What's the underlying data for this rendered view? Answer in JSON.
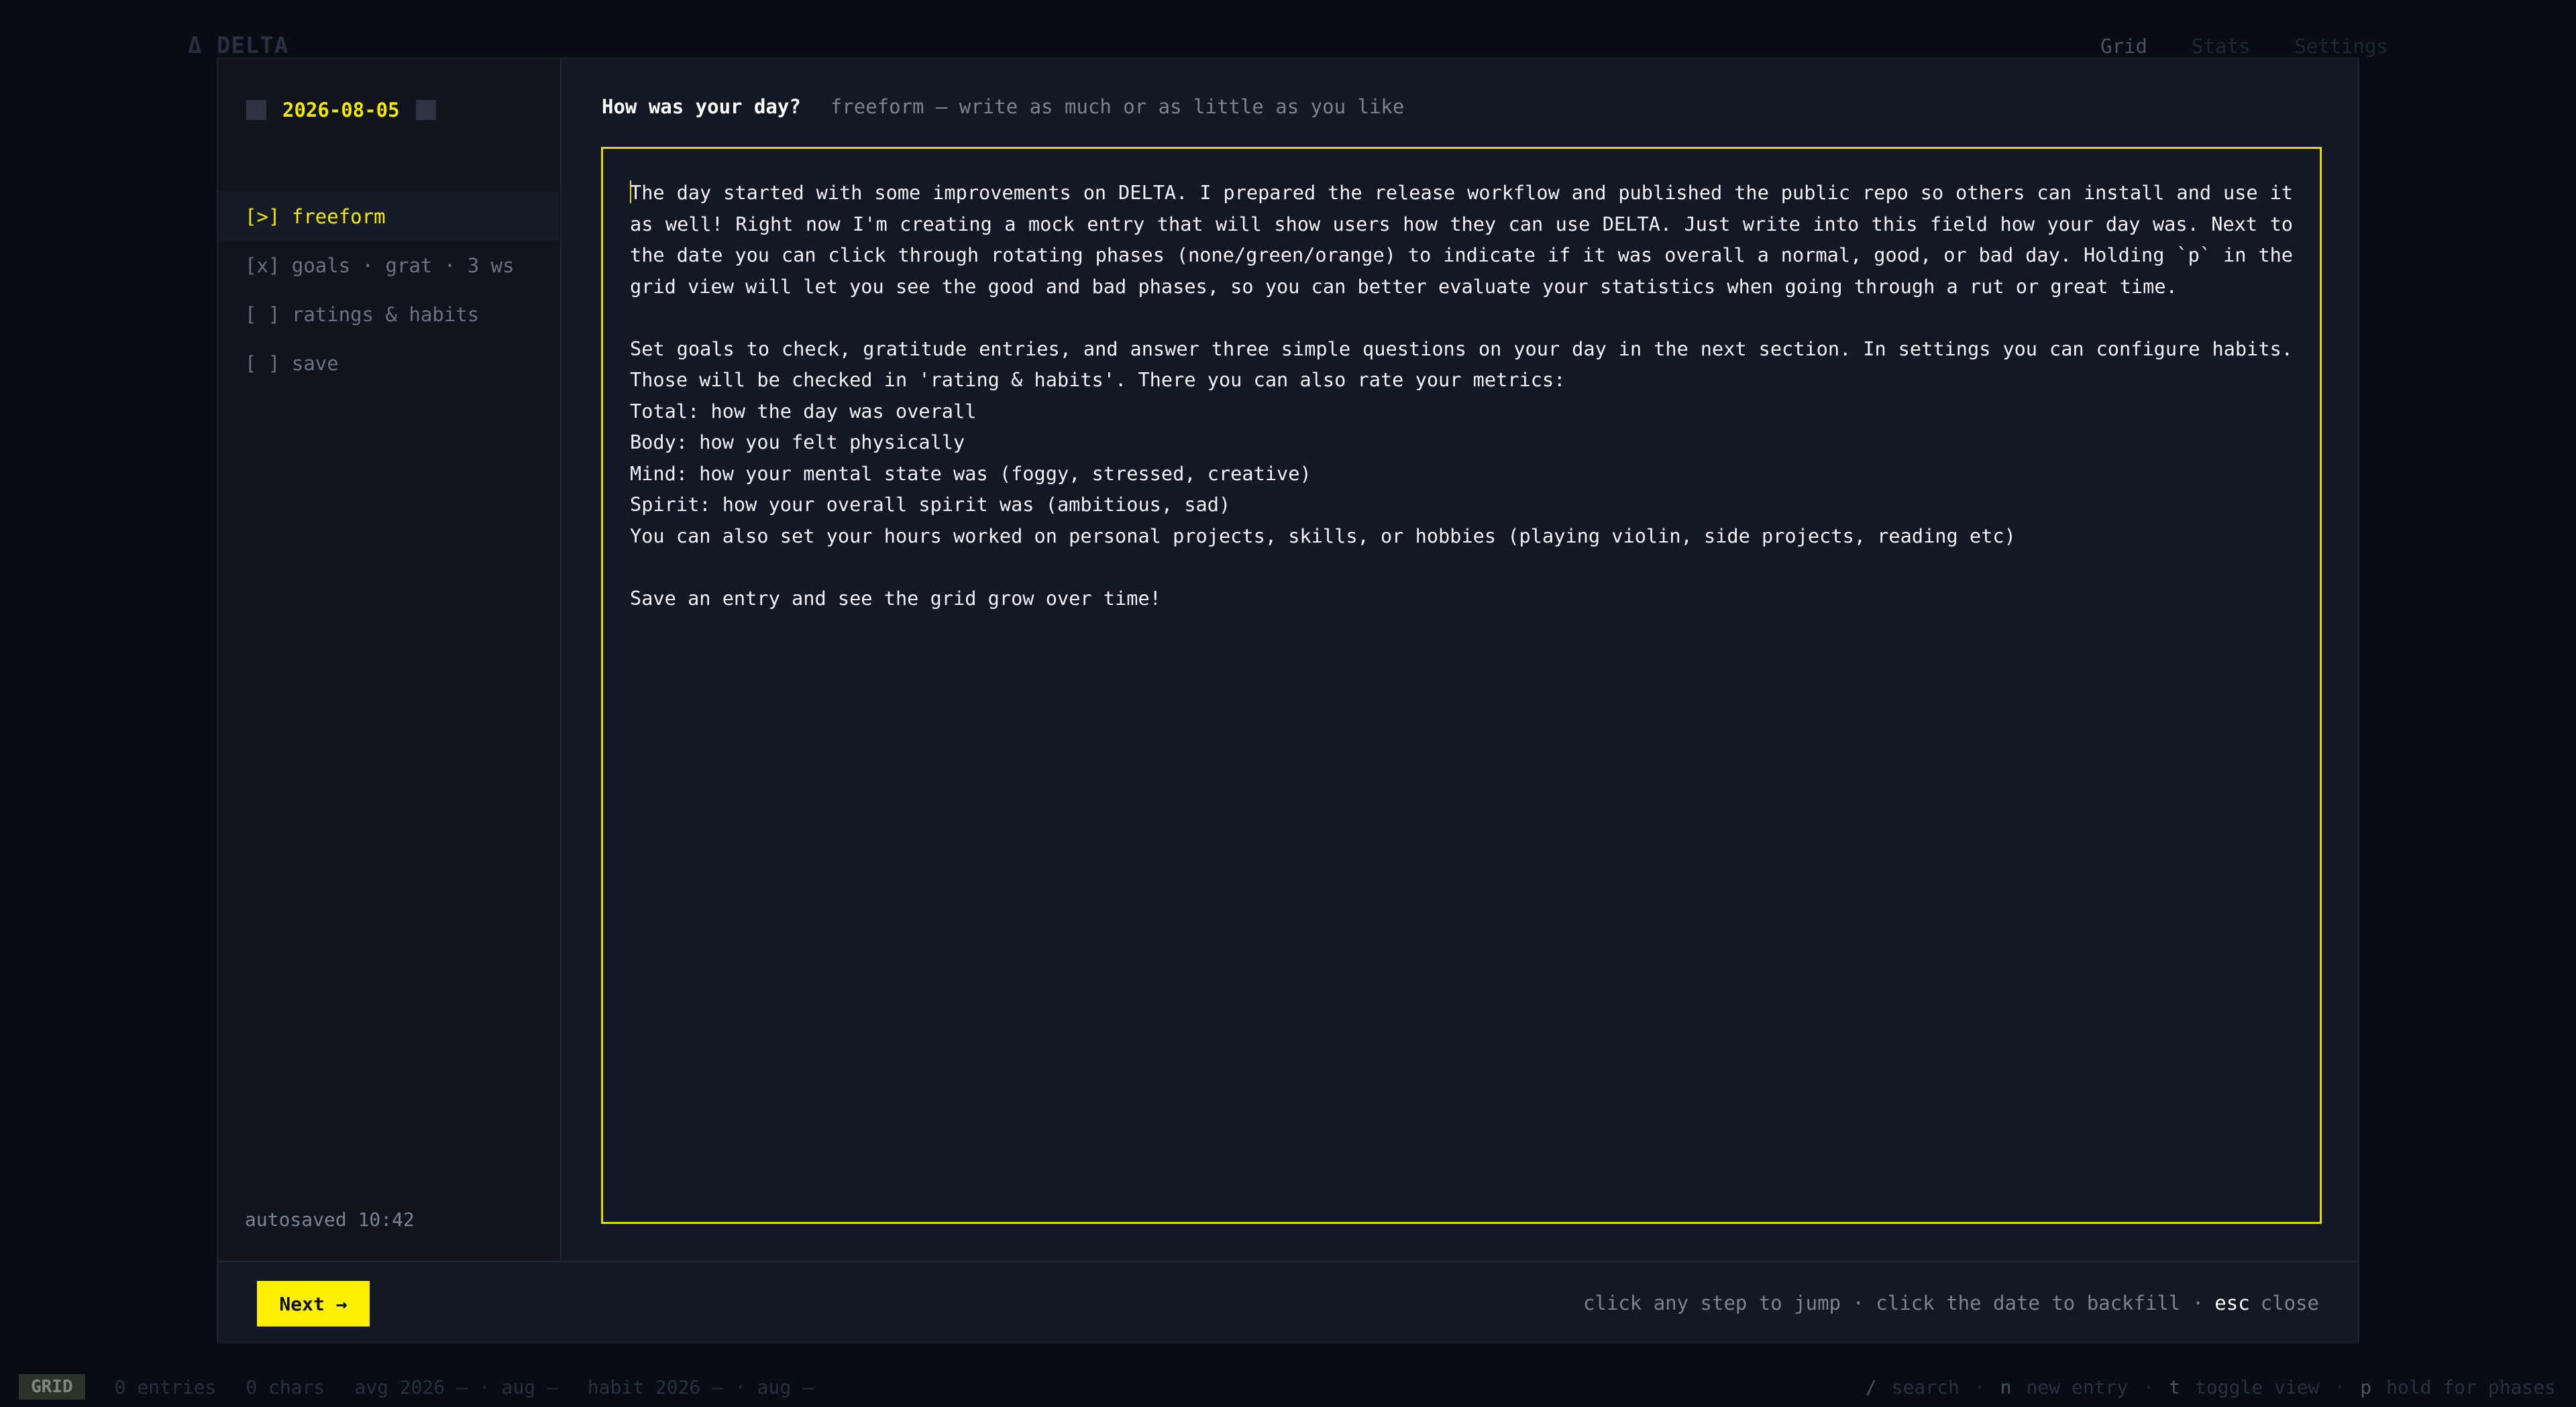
{
  "app": {
    "brand": "Δ DELTA"
  },
  "topnav": [
    "Grid",
    "Stats",
    "Settings"
  ],
  "statusbar": {
    "mode": "GRID",
    "entries": "0 entries",
    "chars": "0 chars",
    "avg": "avg 2026 — · aug —",
    "habit": "habit 2026 — · aug —",
    "shortcuts": [
      {
        "key": "/",
        "label": "search"
      },
      {
        "key": "n",
        "label": "new entry"
      },
      {
        "key": "t",
        "label": "toggle view"
      },
      {
        "key": "p",
        "label": "hold for phases"
      }
    ]
  },
  "modal": {
    "date": "2026-08-05",
    "steps": [
      {
        "marker": "[>]",
        "label": "freeform"
      },
      {
        "marker": "[x]",
        "label": "goals · grat · 3 ws"
      },
      {
        "marker": "[ ]",
        "label": "ratings & habits"
      },
      {
        "marker": "[ ]",
        "label": "save"
      }
    ],
    "autosaved": "autosaved 10:42",
    "prompt_title": "How was your day?",
    "prompt_hint": "freeform — write as much or as little as you like",
    "entry_text": "The day started with some improvements on DELTA. I prepared the release workflow and published the public repo so others can install and use it as well! Right now I'm creating a mock entry that will show users how they can use DELTA. Just write into this field how your day was. Next to the date you can click through rotating phases (none/green/orange) to indicate if it was overall a normal, good, or bad day. Holding `p` in the grid view will let you see the good and bad phases, so you can better evaluate your statistics when going through a rut or great time.\n\nSet goals to check, gratitude entries, and answer three simple questions on your day in the next section. In settings you can configure habits. Those will be checked in 'rating & habits'. There you can also rate your metrics:\nTotal: how the day was overall\nBody: how you felt physically\nMind: how your mental state was (foggy, stressed, creative)\nSpirit: how your overall spirit was (ambitious, sad)\nYou can also set your hours worked on personal projects, skills, or hobbies (playing violin, side projects, reading etc)\n\nSave an entry and see the grid grow over time!",
    "next_label": "Next →",
    "footer_hint_a": "click any step to jump · click the date to backfill ·",
    "footer_hint_key": "esc",
    "footer_hint_b": "close"
  },
  "colors": {
    "accent": "#f6e900",
    "background": "#070b12",
    "panel": "#131924"
  }
}
